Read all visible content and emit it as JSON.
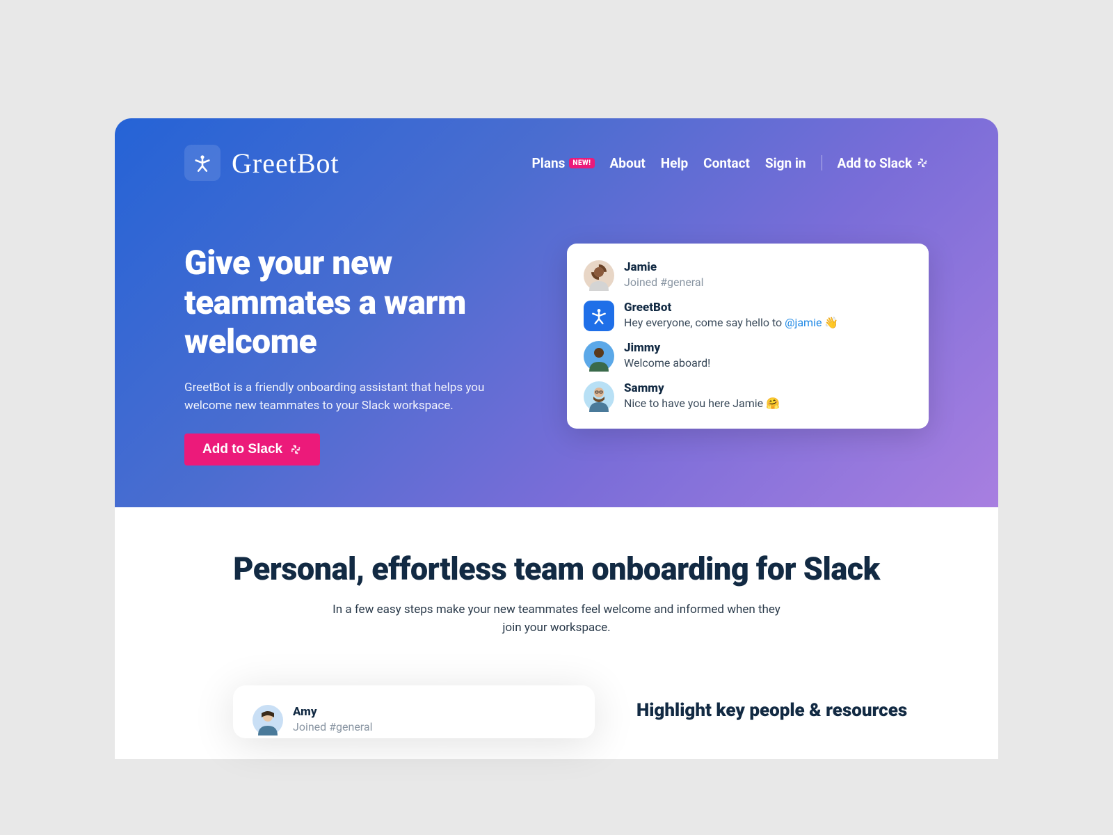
{
  "brand": {
    "name": "GreetBot"
  },
  "nav": {
    "plans": "Plans",
    "plans_badge": "NEW!",
    "about": "About",
    "help": "Help",
    "contact": "Contact",
    "signin": "Sign in",
    "add_to_slack": "Add to Slack"
  },
  "hero": {
    "title": "Give your new teammates a warm welcome",
    "subtitle": "GreetBot is a friendly onboarding assistant that helps you welcome new teammates to your Slack workspace.",
    "cta": "Add to Slack"
  },
  "chat": {
    "messages": [
      {
        "name": "Jamie",
        "text": "Joined #general",
        "type": "joined",
        "avatar_bg": "#e8d6c6"
      },
      {
        "name": "GreetBot",
        "text_prefix": "Hey everyone, come say hello to ",
        "mention": "@jamie",
        "text_suffix": " 👋",
        "type": "app",
        "avatar_bg": "#1f6fe8"
      },
      {
        "name": "Jimmy",
        "text": "Welcome aboard!",
        "type": "user",
        "avatar_bg": "#f2a65a"
      },
      {
        "name": "Sammy",
        "text": "Nice to have you here Jamie 🤗",
        "type": "user",
        "avatar_bg": "#d8c4b0"
      }
    ]
  },
  "section": {
    "title": "Personal, effortless team onboarding for Slack",
    "subtitle": "In a few easy steps make your new teammates feel welcome and informed when they join your workspace."
  },
  "feature": {
    "heading": "Highlight key people & resources",
    "card_messages": [
      {
        "name": "Amy",
        "text": "Joined #general",
        "type": "joined",
        "avatar_bg": "#c9dff5"
      }
    ]
  }
}
